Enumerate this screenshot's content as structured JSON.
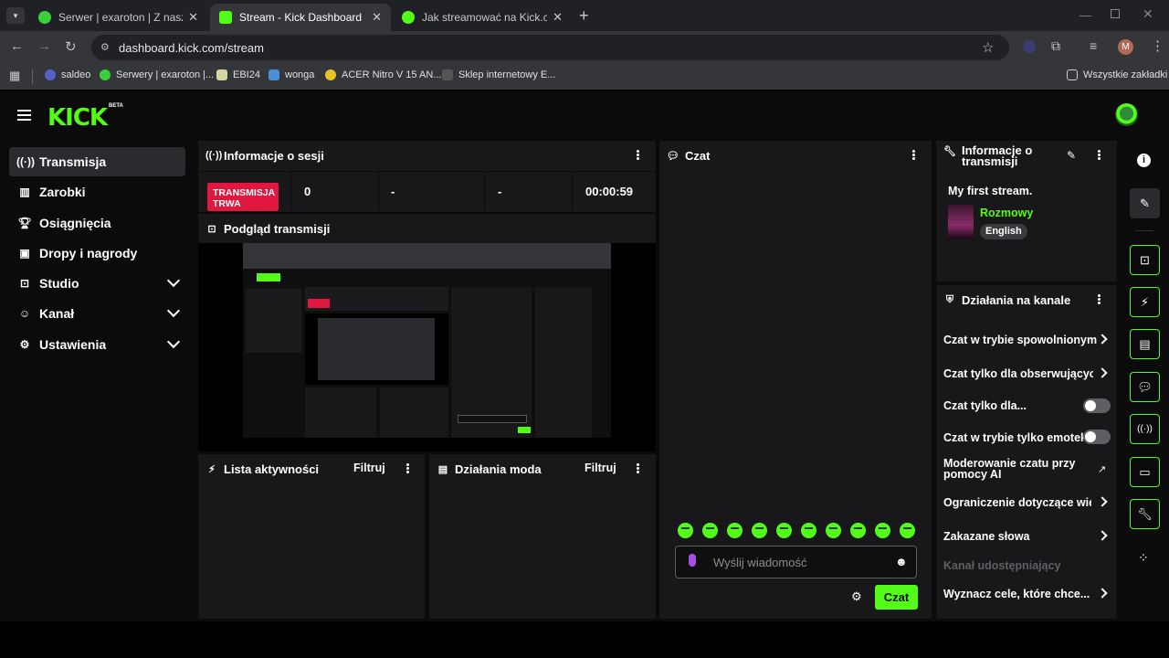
{
  "browser": {
    "tabs": [
      {
        "title": "Serwer | exaroton | Z naszymi zr",
        "active": false
      },
      {
        "title": "Stream - Kick Dashboard",
        "active": true
      },
      {
        "title": "Jak streamować na Kick.com | C",
        "active": false
      }
    ],
    "url": "dashboard.kick.com/stream",
    "profile_initial": "M",
    "bookmarks": [
      "saldeo",
      "Serwery | exaroton |...",
      "EBI24",
      "wonga",
      "ACER Nitro V 15 AN...",
      "Sklep internetowy E..."
    ],
    "all_bookmarks": "Wszystkie zakładki"
  },
  "brand": {
    "logo": "KICK",
    "badge": "BETA",
    "accent": "#53fc18"
  },
  "sidebar": {
    "items": [
      {
        "label": "Transmisja",
        "icon": "broadcast-icon"
      },
      {
        "label": "Zarobki",
        "icon": "earnings-icon"
      },
      {
        "label": "Osiągnięcia",
        "icon": "trophy-icon"
      },
      {
        "label": "Dropy i nagrody",
        "icon": "gift-icon"
      },
      {
        "label": "Studio",
        "icon": "studio-icon"
      },
      {
        "label": "Kanał",
        "icon": "channel-icon"
      },
      {
        "label": "Ustawienia",
        "icon": "settings-icon"
      }
    ]
  },
  "session": {
    "title": "Informacje o sesji",
    "status": "TRANSMISJA TRWA",
    "stat1": "0",
    "stat2": "-",
    "stat3": "-",
    "duration": "00:00:59"
  },
  "preview": {
    "title": "Podgląd transmisji"
  },
  "activity": {
    "title": "Lista aktywności",
    "filter": "Filtruj"
  },
  "modactions": {
    "title": "Działania moda",
    "filter": "Filtruj"
  },
  "chat": {
    "title": "Czat",
    "placeholder": "Wyślij wiadomość",
    "send": "Czat"
  },
  "stream_info": {
    "title": "Informacje o transmisji",
    "stream_title": "My first stream.",
    "category": "Rozmowy",
    "language": "English"
  },
  "channel_actions": {
    "title": "Działania na kanale",
    "slow_mode": "Czat w trybie spowolnionym",
    "followers_only": "Czat tylko dla obserwujących",
    "subs_only": "Czat tylko dla...",
    "emote_only": "Czat w trybie tylko emotek",
    "ai_mod": "Moderowanie czatu przy pomocy AI",
    "restriction": "Ograniczenie dotyczące wieku",
    "banned_words": "Zakazane słowa",
    "shared_channel": "Kanał udostępniający",
    "goals": "Wyznacz cele, które chce..."
  }
}
